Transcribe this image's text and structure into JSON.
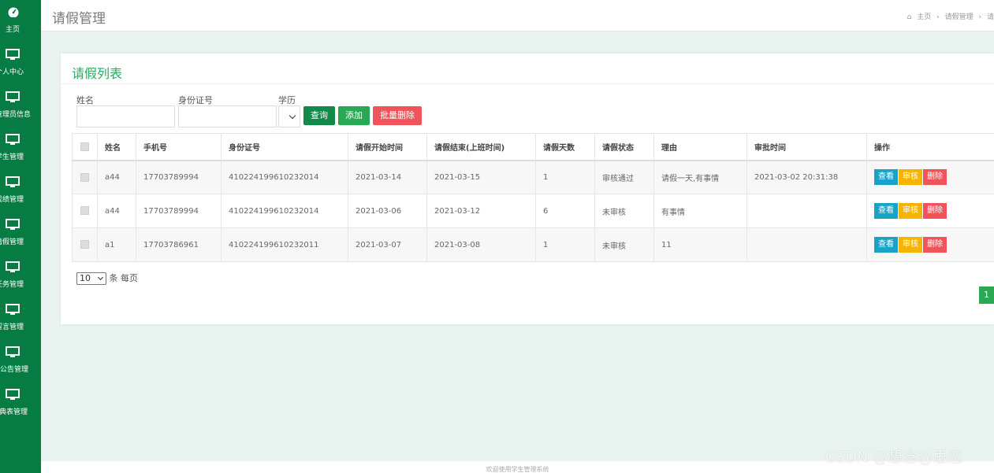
{
  "sidebar": {
    "items": [
      {
        "label": "主页",
        "icon": "dashboard-icon"
      },
      {
        "label": "个人中心",
        "icon": "monitor-icon"
      },
      {
        "label": "管理员信息",
        "icon": "monitor-icon"
      },
      {
        "label": "学生管理",
        "icon": "monitor-icon"
      },
      {
        "label": "成绩管理",
        "icon": "monitor-icon"
      },
      {
        "label": "请假管理",
        "icon": "monitor-icon"
      },
      {
        "label": "任务管理",
        "icon": "monitor-icon"
      },
      {
        "label": "留言管理",
        "icon": "monitor-icon"
      },
      {
        "label": "系统公告管理",
        "icon": "monitor-icon"
      },
      {
        "label": "字典表管理",
        "icon": "monitor-icon"
      }
    ]
  },
  "header": {
    "title": "请假管理",
    "breadcrumb": [
      "主页",
      "请假管理",
      "请"
    ]
  },
  "card": {
    "title": "请假列表"
  },
  "filters": {
    "name_label": "姓名",
    "idcard_label": "身份证号",
    "edu_label": "学历",
    "name_value": "",
    "idcard_value": ""
  },
  "buttons": {
    "query": "查询",
    "add": "添加",
    "bulk_delete": "批量删除"
  },
  "table": {
    "headers": [
      "姓名",
      "手机号",
      "身份证号",
      "请假开始时间",
      "请假结束(上班时间)",
      "请假天数",
      "请假状态",
      "理由",
      "审批时间",
      "操作"
    ],
    "rows": [
      [
        "a44",
        "17703789994",
        "410224199610232014",
        "2021-03-14",
        "2021-03-15",
        "1",
        "审核通过",
        "请假一天,有事情",
        "2021-03-02 20:31:38"
      ],
      [
        "a44",
        "17703789994",
        "410224199610232014",
        "2021-03-06",
        "2021-03-12",
        "6",
        "未审核",
        "有事情",
        ""
      ],
      [
        "a1",
        "17703786961",
        "410224199610232011",
        "2021-03-07",
        "2021-03-08",
        "1",
        "未审核",
        "11",
        ""
      ]
    ],
    "row_actions": {
      "view": "查看",
      "audit": "审核",
      "delete": "删除"
    }
  },
  "pagination": {
    "page_size": "10",
    "page_size_suffix": "条 每页",
    "current_page": "1"
  },
  "footer": {
    "text": "欢迎使用学生管理系统"
  },
  "watermark": "CSDN @想念@思恋",
  "colors": {
    "sidebar": "#067c42",
    "accent": "#2aa853",
    "danger": "#f0545a",
    "info": "#1aa3c8",
    "warning": "#f6b400"
  }
}
